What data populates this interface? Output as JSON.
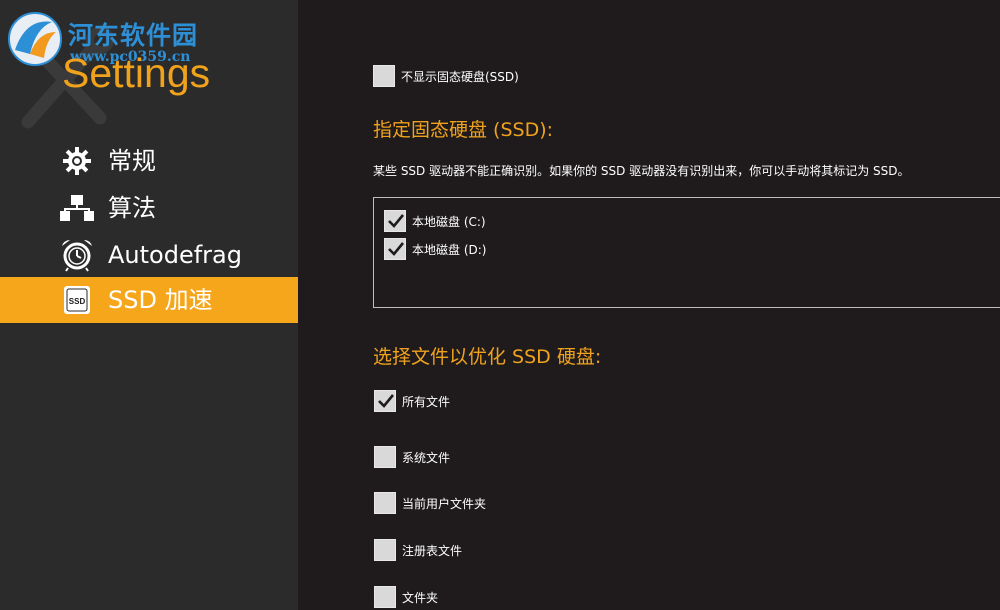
{
  "watermark": {
    "text": "河东软件园",
    "url": "www.pc0359.cn"
  },
  "sidebar": {
    "title": "Settings",
    "items": [
      {
        "label": "常规",
        "icon": "gear-icon",
        "active": false
      },
      {
        "label": "算法",
        "icon": "algorithm-icon",
        "active": false
      },
      {
        "label": "Autodefrag",
        "icon": "alarm-clock-icon",
        "active": false
      },
      {
        "label": "SSD 加速",
        "icon": "ssd-icon",
        "active": true
      }
    ],
    "ssd_icon_text": "SSD"
  },
  "main": {
    "hide_ssd": {
      "label": "不显示固态硬盘(SSD)",
      "checked": false
    },
    "assign_ssd_heading": "指定固态硬盘 (SSD):",
    "assign_ssd_desc": "某些 SSD 驱动器不能正确识别。如果你的 SSD 驱动器没有识别出来，你可以手动将其标记为 SSD。",
    "drives": [
      {
        "label": "本地磁盘 (C:)",
        "checked": true
      },
      {
        "label": "本地磁盘 (D:)",
        "checked": true
      }
    ],
    "optimize_heading": "选择文件以优化 SSD 硬盘:",
    "file_options": [
      {
        "label": "所有文件",
        "checked": true
      },
      {
        "label": "系统文件",
        "checked": false
      },
      {
        "label": "当前用户文件夹",
        "checked": false
      },
      {
        "label": "注册表文件",
        "checked": false
      },
      {
        "label": "文件夹",
        "checked": false
      }
    ]
  },
  "colors": {
    "accent": "#f5a61b",
    "sidebar_bg": "#2b2b2b",
    "main_bg": "#1f1b1c",
    "watermark": "#2d8fd6"
  }
}
